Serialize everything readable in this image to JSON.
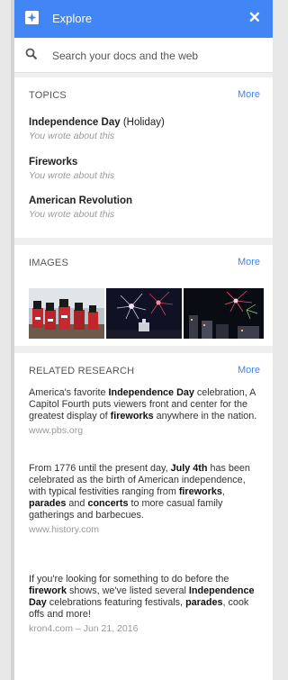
{
  "header": {
    "title": "Explore",
    "close_label": "✕"
  },
  "search": {
    "placeholder": "Search your docs and the web"
  },
  "topics": {
    "title": "TOPICS",
    "more": "More",
    "items": [
      {
        "name": "Independence Day",
        "type": " (Holiday)",
        "note": "You wrote about this"
      },
      {
        "name": "Fireworks",
        "type": "",
        "note": "You wrote about this"
      },
      {
        "name": "American Revolution",
        "type": "",
        "note": "You wrote about this"
      }
    ]
  },
  "images": {
    "title": "IMAGES",
    "more": "More",
    "thumbnails": [
      "colonial-soldiers-parade",
      "fireworks-over-capitol",
      "fireworks-over-city"
    ]
  },
  "research": {
    "title": "RELATED RESEARCH",
    "more": "More",
    "items": [
      {
        "parts": [
          {
            "t": "America's favorite ",
            "b": false
          },
          {
            "t": "Independence Day",
            "b": true
          },
          {
            "t": " celebration, A Capitol Fourth puts viewers front and center for the greatest display of ",
            "b": false
          },
          {
            "t": "fireworks",
            "b": true
          },
          {
            "t": " anywhere in the nation.",
            "b": false
          }
        ],
        "source": "www.pbs.org"
      },
      {
        "parts": [
          {
            "t": "From 1776 until the present day, ",
            "b": false
          },
          {
            "t": "July 4th",
            "b": true
          },
          {
            "t": " has been celebrated as the birth of American independence, with typical festivities ranging from ",
            "b": false
          },
          {
            "t": "fireworks",
            "b": true
          },
          {
            "t": ", ",
            "b": false
          },
          {
            "t": "parades",
            "b": true
          },
          {
            "t": " and ",
            "b": false
          },
          {
            "t": "concerts",
            "b": true
          },
          {
            "t": " to more casual family gatherings and barbecues.",
            "b": false
          }
        ],
        "source": "www.history.com"
      },
      {
        "parts": [
          {
            "t": "If you're looking for something to do before the ",
            "b": false
          },
          {
            "t": "firework",
            "b": true
          },
          {
            "t": " shows, we've listed several ",
            "b": false
          },
          {
            "t": "Independence Day",
            "b": true
          },
          {
            "t": " celebrations featuring festivals, ",
            "b": false
          },
          {
            "t": "parades",
            "b": true
          },
          {
            "t": ", cook offs and more!",
            "b": false
          }
        ],
        "source": "kron4.com – Jun 21, 2016"
      }
    ]
  },
  "colors": {
    "accent": "#4285f4",
    "background": "#efefef",
    "muted": "#999999"
  }
}
